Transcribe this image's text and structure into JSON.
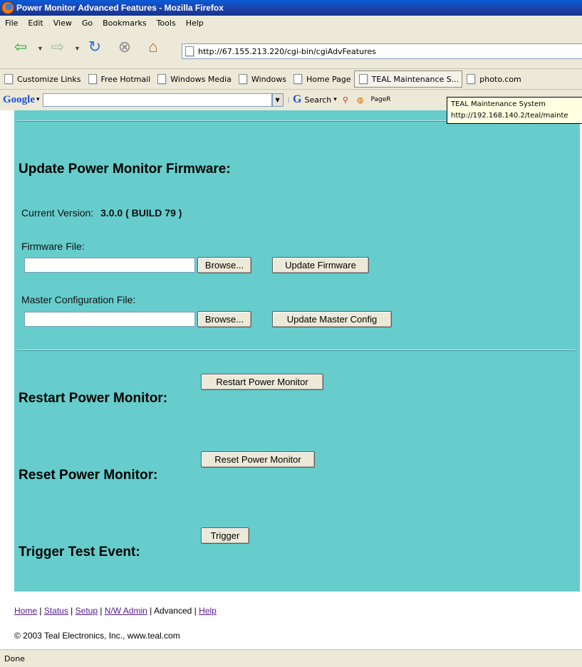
{
  "window": {
    "title": "Power Monitor Advanced Features - Mozilla Firefox"
  },
  "menu": [
    "File",
    "Edit",
    "View",
    "Go",
    "Bookmarks",
    "Tools",
    "Help"
  ],
  "nav": {
    "url": "http://67.155.213.220/cgi-bin/cgiAdvFeatures"
  },
  "bookmarks": [
    "Customize Links",
    "Free Hotmail",
    "Windows Media",
    "Windows",
    "Home Page",
    "TEAL Maintenance S...",
    "photo.com"
  ],
  "google_toolbar": {
    "logo": "Google",
    "search_label": "Search",
    "pagerank_label": "PageR"
  },
  "tooltip": {
    "line1": "TEAL Maintenance System",
    "line2": "http://192.168.140.2/teal/mainte"
  },
  "page": {
    "firmware_heading": "Update Power Monitor Firmware:",
    "current_version_label": "Current Version:",
    "current_version_value": "3.0.0 ( BUILD 79 )",
    "firmware_file_label": "Firmware File:",
    "browse_label": "Browse...",
    "update_firmware_label": "Update Firmware",
    "master_config_label": "Master Configuration File:",
    "update_master_label": "Update Master Config",
    "restart_heading": "Restart Power Monitor:",
    "restart_button": "Restart Power Monitor",
    "reset_heading": "Reset Power Monitor:",
    "reset_button": "Reset Power Monitor",
    "trigger_heading": "Trigger Test Event:",
    "trigger_button": "Trigger"
  },
  "footer": {
    "links": {
      "home": "Home",
      "status": "Status",
      "setup": "Setup",
      "nw_admin": "N/W Admin",
      "advanced": "Advanced",
      "help": "Help"
    },
    "separator": " | ",
    "copyright": "© 2003 Teal Electronics, Inc., www.teal.com"
  },
  "status": {
    "text": "Done"
  }
}
